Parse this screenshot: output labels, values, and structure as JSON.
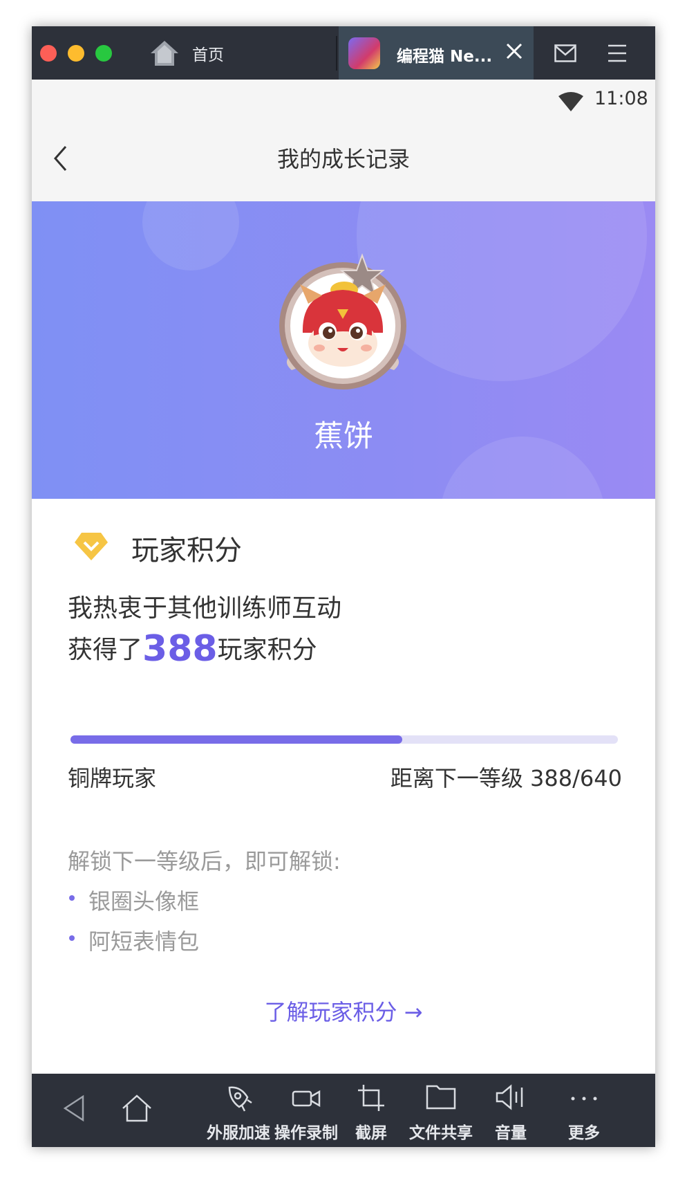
{
  "window": {
    "home_tab_label": "首页",
    "active_tab_label": "编程猫 Ne..."
  },
  "status_bar": {
    "time": "11:08"
  },
  "header": {
    "title": "我的成长记录"
  },
  "profile": {
    "nickname": "蕉饼"
  },
  "points": {
    "title": "玩家积分",
    "desc_line1": "我热衷于其他训练师互动",
    "desc_prefix": "获得了",
    "value": "388",
    "desc_suffix": "玩家积分",
    "progress_fraction": 0.606,
    "level_name": "铜牌玩家",
    "next_level_text": "距离下一等级 388/640",
    "unlock_title": "解锁下一等级后，即可解锁:",
    "unlock_items": [
      "银圈头像框",
      "阿短表情包"
    ],
    "learn_more": "了解玩家积分 →"
  },
  "toolbar": {
    "accelerate": "外服加速",
    "record": "操作录制",
    "screenshot": "截屏",
    "file_share": "文件共享",
    "volume": "音量",
    "more": "更多"
  },
  "colors": {
    "accent": "#6b5ee6",
    "progress_fill": "#786ce8",
    "banner_start": "#7f90f4",
    "banner_end": "#9a8af3",
    "chrome_dark": "#2d313a"
  }
}
